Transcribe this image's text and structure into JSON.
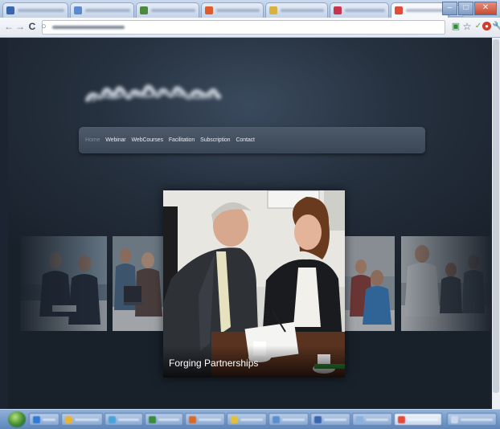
{
  "browser": {
    "tabs": [
      {
        "color": "#3a66b0",
        "active": false
      },
      {
        "color": "#5b8ad0",
        "active": false
      },
      {
        "color": "#4a8a3a",
        "active": false
      },
      {
        "color": "#e05b2a",
        "active": false
      },
      {
        "color": "#d8b23a",
        "active": false
      },
      {
        "color": "#c8344b",
        "active": false
      },
      {
        "color": "#e24a3a",
        "active": true
      }
    ],
    "toolbar_icons": [
      "back-icon",
      "forward-icon",
      "reload-icon",
      "page-icon",
      "bookmark-star-icon",
      "extension-icon",
      "adblock-icon",
      "wrench-icon"
    ]
  },
  "nav": {
    "items": [
      {
        "label": "Home",
        "active": true
      },
      {
        "label": "Webinar",
        "active": false
      },
      {
        "label": "WebCourses",
        "active": false
      },
      {
        "label": "Facilitation",
        "active": false
      },
      {
        "label": "Subscription",
        "active": false
      },
      {
        "label": "Contact",
        "active": false
      }
    ]
  },
  "carousel": {
    "caption": "Forging Partnerships"
  },
  "colors": {
    "page_bg": "#1b2430",
    "nav_bg": "#424e5d",
    "nav_active": "#7f8c9c",
    "caption_text": "#ffffff"
  }
}
